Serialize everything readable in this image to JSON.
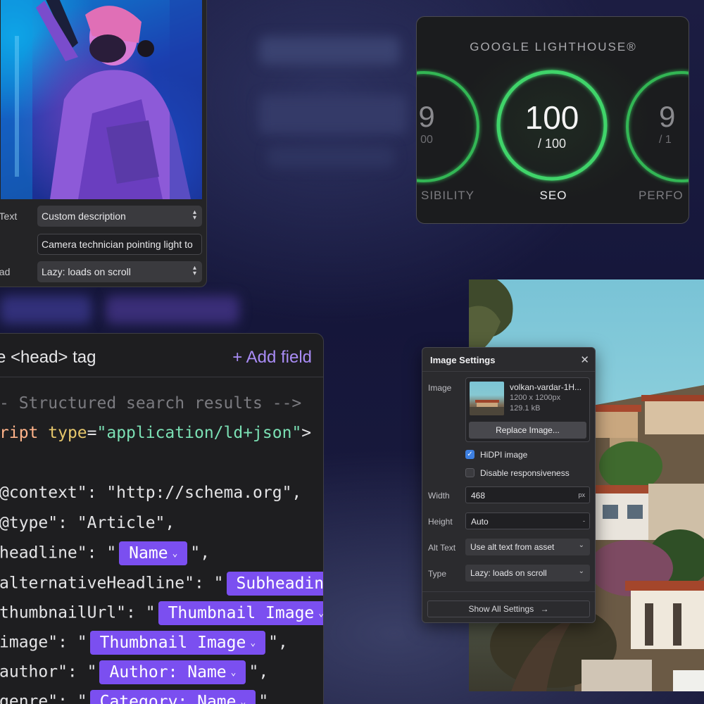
{
  "image_panel": {
    "alt_label": "t Text",
    "alt_value": "Custom description",
    "alt_text_input": "Camera technician pointing light to",
    "load_label": "oad",
    "load_value": "Lazy: loads on scroll"
  },
  "lighthouse": {
    "title": "GOOGLE LIGHTHOUSE®",
    "left_score": "9",
    "left_total": "00",
    "left_label": "SIBILITY",
    "center_score": "100",
    "center_total": "/ 100",
    "center_label": "SEO",
    "right_score": "9",
    "right_total": "/ 1",
    "right_label": "PERFO",
    "accent": "#3fd46a"
  },
  "code_panel": {
    "header_title": "e <head> tag",
    "add_field": "+ Add field",
    "comment": "- Structured search results -->",
    "script_tag": "ript",
    "script_attr": "type",
    "script_eq": "=",
    "script_value": "\"application/ld+json\"",
    "script_close": ">",
    "context_line": "@context\": \"http://schema.org\",",
    "type_line": "@type\": \"Article\",",
    "headline_key": "headline\": \"",
    "headline_pill": "Name",
    "headline_end": "\",",
    "alt_headline_key": "alternativeHeadline\": \"",
    "alt_headline_pill": "Subheadin",
    "thumbnail_key": "thumbnailUrl\": \"",
    "thumbnail_pill": "Thumbnail Image",
    "image_key": "image\": \"",
    "image_pill": "Thumbnail Image",
    "image_end": "\",",
    "author_key": "author\": \"",
    "author_pill": "Author: Name",
    "author_end": "\",",
    "genre_key": "genre\": \"",
    "genre_pill": "Category: Name",
    "genre_end": "\"",
    "pill_color": "#7b4ff0"
  },
  "dialog": {
    "title": "Image Settings",
    "image_label": "Image",
    "file_name": "volkan-vardar-1H...",
    "dimensions": "1200 x 1200px",
    "file_size": "129.1 kB",
    "replace_button": "Replace Image...",
    "hidpi_label": "HiDPI image",
    "hidpi_checked": true,
    "disable_responsive_label": "Disable responsiveness",
    "disable_responsive_checked": false,
    "width_label": "Width",
    "width_value": "468",
    "width_unit": "px",
    "height_label": "Height",
    "height_value": "Auto",
    "height_unit": "-",
    "alt_label": "Alt Text",
    "alt_value": "Use alt text from asset",
    "type_label": "Type",
    "type_value": "Lazy: loads on scroll",
    "show_all": "Show All Settings",
    "show_all_arrow": "→",
    "close_glyph": "✕"
  }
}
